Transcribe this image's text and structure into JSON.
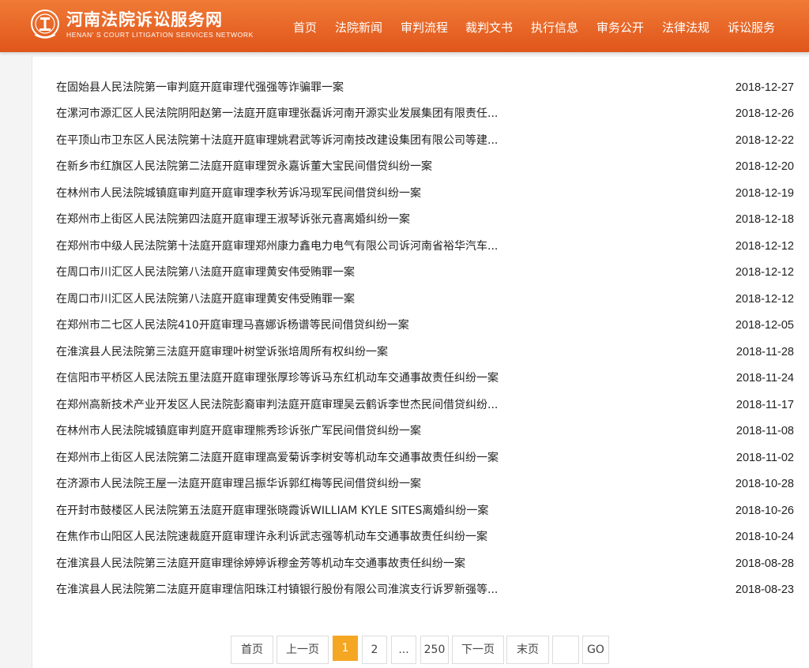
{
  "header": {
    "title": "河南法院诉讼服务网",
    "subtitle": "HENAN' S COURT LITIGATION SERVICES NETWORK",
    "nav": [
      "首页",
      "法院新闻",
      "审判流程",
      "裁判文书",
      "执行信息",
      "审务公开",
      "法律法规",
      "诉讼服务"
    ]
  },
  "cases": [
    {
      "title": "在固始县人民法院第一审判庭开庭审理代强强等诈骗罪一案",
      "date": "2018-12-27"
    },
    {
      "title": "在漯河市源汇区人民法院阴阳赵第一法庭开庭审理张磊诉河南开源实业发展集团有限责任...",
      "date": "2018-12-26"
    },
    {
      "title": "在平顶山市卫东区人民法院第十法庭开庭审理姚君武等诉河南技改建设集团有限公司等建...",
      "date": "2018-12-22"
    },
    {
      "title": "在新乡市红旗区人民法院第二法庭开庭审理贺永嘉诉董大宝民间借贷纠纷一案",
      "date": "2018-12-20"
    },
    {
      "title": "在林州市人民法院城镇庭审判庭开庭审理李秋芳诉冯现军民间借贷纠纷一案",
      "date": "2018-12-19"
    },
    {
      "title": "在郑州市上街区人民法院第四法庭开庭审理王淑琴诉张元喜离婚纠纷一案",
      "date": "2018-12-18"
    },
    {
      "title": "在郑州市中级人民法院第十法庭开庭审理郑州康力鑫电力电气有限公司诉河南省裕华汽车...",
      "date": "2018-12-12"
    },
    {
      "title": "在周口市川汇区人民法院第八法庭开庭审理黄安伟受贿罪一案",
      "date": "2018-12-12"
    },
    {
      "title": "在周口市川汇区人民法院第八法庭开庭审理黄安伟受贿罪一案",
      "date": "2018-12-12"
    },
    {
      "title": "在郑州市二七区人民法院410开庭审理马喜娜诉杨谱等民间借贷纠纷一案",
      "date": "2018-12-05"
    },
    {
      "title": "在淮滨县人民法院第三法庭开庭审理叶树堂诉张培周所有权纠纷一案",
      "date": "2018-11-28"
    },
    {
      "title": "在信阳市平桥区人民法院五里法庭开庭审理张厚珍等诉马东红机动车交通事故责任纠纷一案",
      "date": "2018-11-24"
    },
    {
      "title": "在郑州高新技术产业开发区人民法院彭裔审判法庭开庭审理吴云鹤诉李世杰民间借贷纠纷...",
      "date": "2018-11-17"
    },
    {
      "title": "在林州市人民法院城镇庭审判庭开庭审理熊秀珍诉张广军民间借贷纠纷一案",
      "date": "2018-11-08"
    },
    {
      "title": "在郑州市上街区人民法院第二法庭开庭审理高爱菊诉李树安等机动车交通事故责任纠纷一案",
      "date": "2018-11-02"
    },
    {
      "title": "在济源市人民法院王屋一法庭开庭审理吕振华诉郭红梅等民间借贷纠纷一案",
      "date": "2018-10-28"
    },
    {
      "title": "在开封市鼓楼区人民法院第五法庭开庭审理张晓霞诉WILLIAM KYLE SITES离婚纠纷一案",
      "date": "2018-10-26"
    },
    {
      "title": "在焦作市山阳区人民法院速裁庭开庭审理许永利诉武志强等机动车交通事故责任纠纷一案",
      "date": "2018-10-24"
    },
    {
      "title": "在淮滨县人民法院第三法庭开庭审理徐婷婷诉穆金芳等机动车交通事故责任纠纷一案",
      "date": "2018-08-28"
    },
    {
      "title": "在淮滨县人民法院第二法庭开庭审理信阳珠江村镇银行股份有限公司淮滨支行诉罗新强等...",
      "date": "2018-08-23"
    }
  ],
  "pagination": {
    "first": "首页",
    "prev": "上一页",
    "current": "1",
    "page2": "2",
    "ellipsis": "...",
    "last_page": "250",
    "next": "下一页",
    "end": "末页",
    "jump_value": "",
    "go": "GO"
  }
}
